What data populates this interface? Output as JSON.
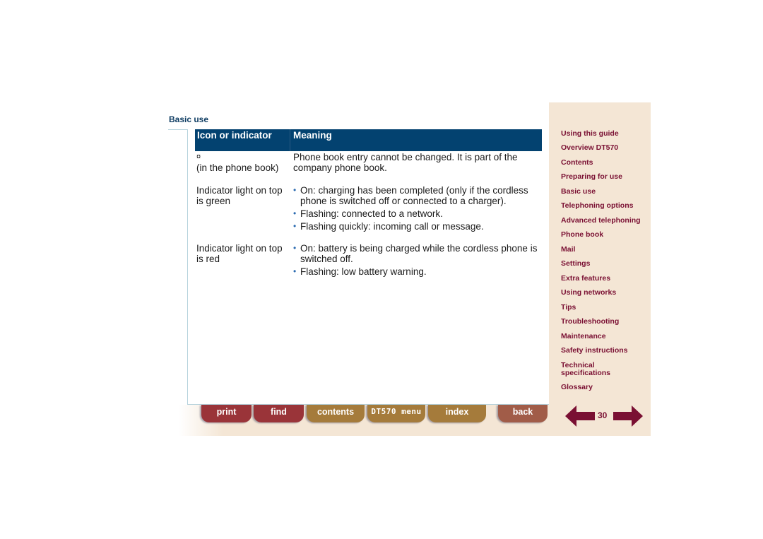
{
  "header": {
    "section_title": "Basic use"
  },
  "table": {
    "columns": [
      "Icon or indicator",
      "Meaning"
    ],
    "rows": [
      {
        "icon": "¤",
        "indicator": "(in the phone book)",
        "meaning": "Phone book entry cannot be changed. It is part of the company phone book."
      },
      {
        "indicator": "Indicator light on top is green",
        "bullets": [
          "On: charging has been completed (only if the cordless phone is switched off or connected to a charger).",
          "Flashing: connected to a network.",
          "Flashing quickly: incoming call or message."
        ]
      },
      {
        "indicator": "Indicator light on top is red",
        "bullets": [
          "On: battery is being charged while the cordless phone is switched off.",
          "Flashing: low battery warning."
        ]
      }
    ]
  },
  "sidebar": {
    "items": [
      "Using this guide",
      "Overview DT570",
      "Contents",
      "Preparing for use",
      "Basic use",
      "Telephoning options",
      "Advanced telephoning",
      "Phone book",
      "Mail",
      "Settings",
      "Extra features",
      "Using networks",
      "Tips",
      "Troubleshooting",
      "Maintenance",
      "Safety instructions",
      "Technical specifications",
      "Glossary"
    ]
  },
  "footer": {
    "tabs": [
      "print",
      "find",
      "contents",
      "DT570 menu",
      "index",
      "back"
    ],
    "page_number": "30",
    "prev_icon": "arrow-left-icon",
    "next_icon": "arrow-right-icon"
  },
  "colors": {
    "header_blue": "#034270",
    "nav_maroon": "#7a1033",
    "sidebar_bg": "#f4e6d5",
    "tab_red": "#9a3439",
    "tab_gold": "#a57b3b",
    "tab_brown": "#a15c48"
  }
}
